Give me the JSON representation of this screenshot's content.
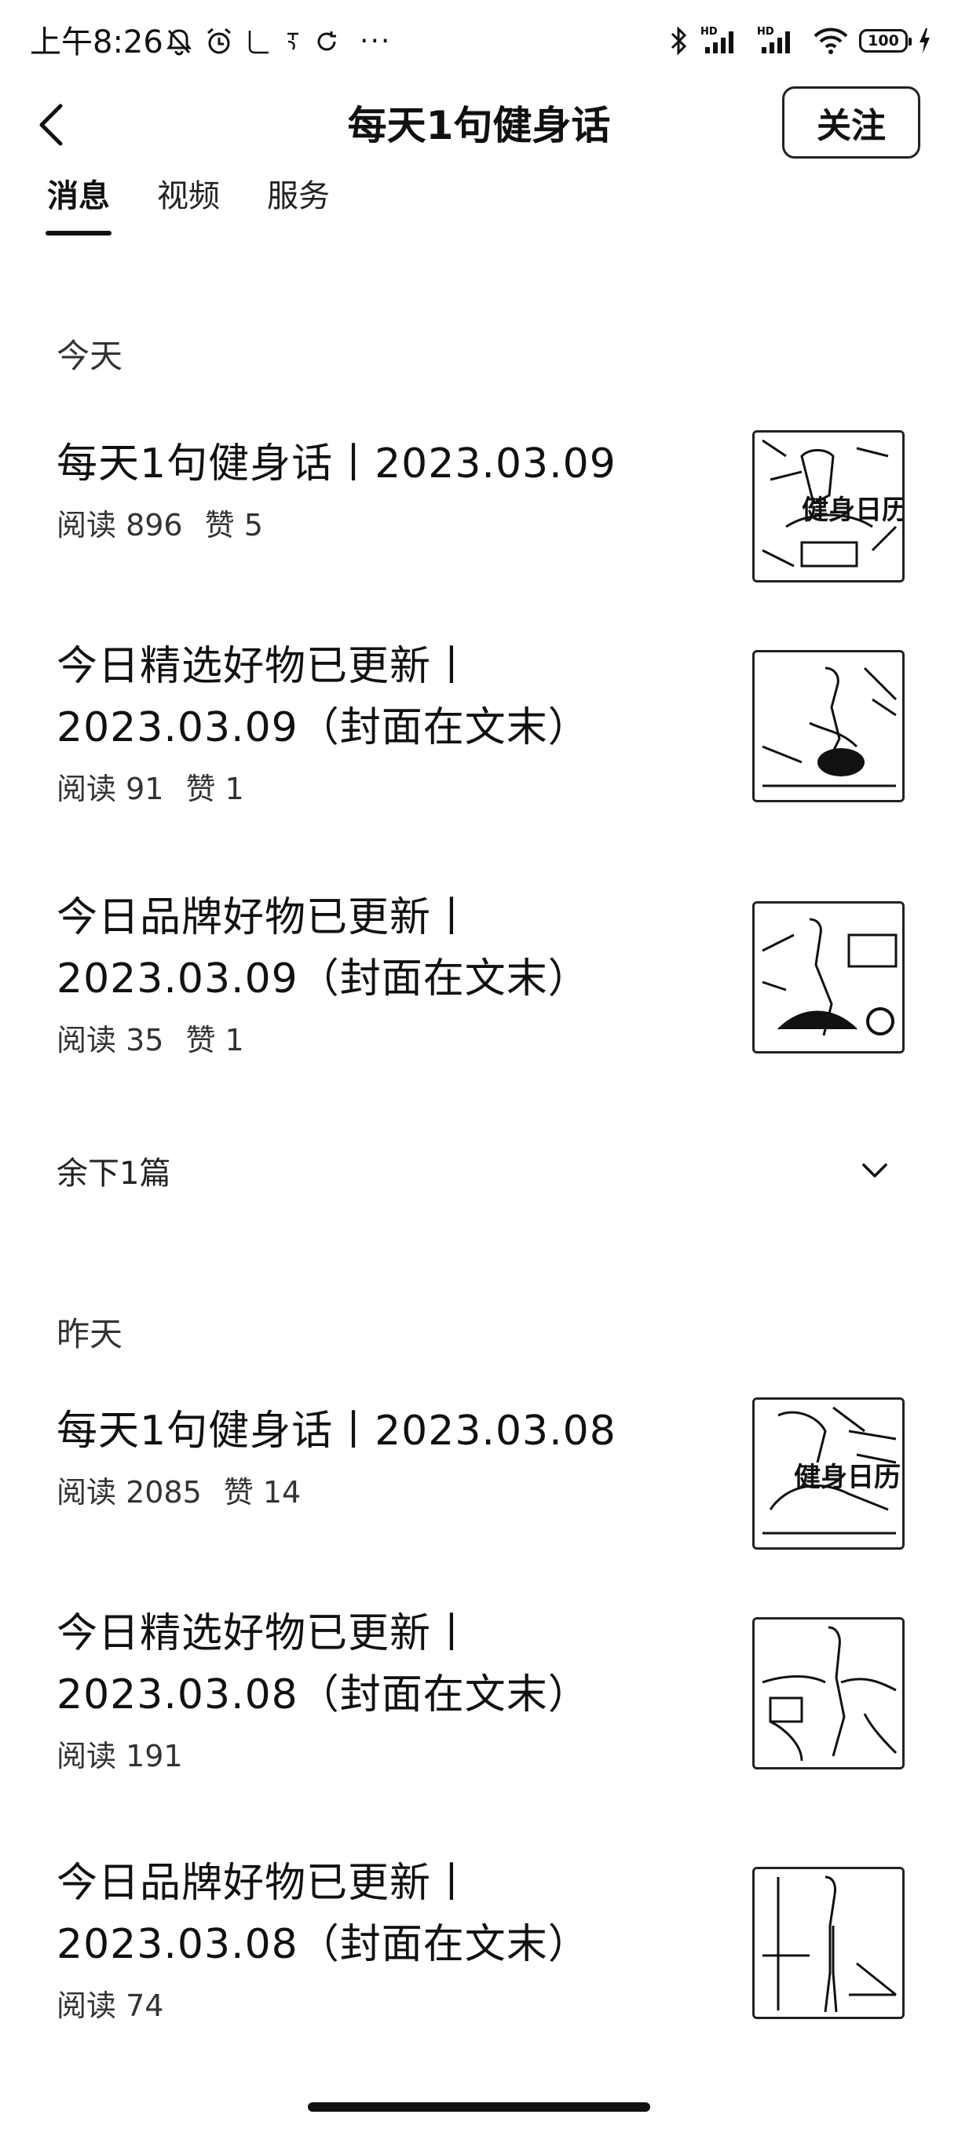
{
  "status_bar": {
    "time": "上午8:26",
    "signal_label_1": "HD",
    "signal_label_2": "HD",
    "battery": "100"
  },
  "header": {
    "title": "每天1句健身话",
    "follow_label": "关注"
  },
  "tabs": [
    {
      "label": "消息",
      "active": true
    },
    {
      "label": "视频",
      "active": false
    },
    {
      "label": "服务",
      "active": false
    }
  ],
  "sections": {
    "today": {
      "label": "今天",
      "articles": [
        {
          "title": "每天1句健身话丨2023.03.09",
          "reads": "阅读 896",
          "likes": "赞 5",
          "thumb_overlay": "健身日历"
        },
        {
          "title": "今日精选好物已更新丨2023.03.09（封面在文末）",
          "reads": "阅读 91",
          "likes": "赞 1"
        },
        {
          "title": "今日品牌好物已更新丨2023.03.09（封面在文末）",
          "reads": "阅读 35",
          "likes": "赞 1"
        }
      ],
      "remaining_label": "余下1篇"
    },
    "yesterday": {
      "label": "昨天",
      "articles": [
        {
          "title": "每天1句健身话丨2023.03.08",
          "reads": "阅读 2085",
          "likes": "赞 14",
          "thumb_overlay": "健身日历"
        },
        {
          "title": "今日精选好物已更新丨2023.03.08（封面在文末）",
          "reads": "阅读 191",
          "likes": ""
        },
        {
          "title": "今日品牌好物已更新丨2023.03.08（封面在文末）",
          "reads": "阅读 74",
          "likes": ""
        }
      ]
    }
  },
  "colors": {
    "text": "#111111",
    "secondary_text": "#333333",
    "background": "#ffffff"
  }
}
